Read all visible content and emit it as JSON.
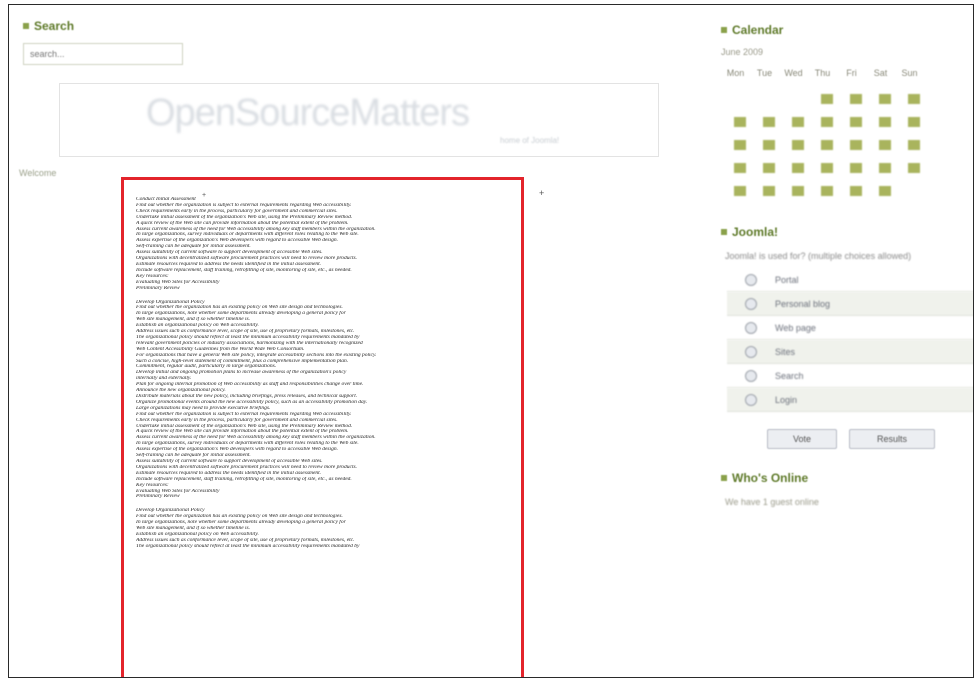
{
  "left": {
    "search_heading": "Search",
    "search_placeholder": "search...",
    "banner_logo": "OpenSourceMatters",
    "banner_tag": "home of Joomla!",
    "side_link": "Welcome"
  },
  "document": {
    "marker_top": "+",
    "marker_right": "+",
    "lines_block1": [
      "Conduct Initial Assessment",
      "Find out whether the organization is subject to external requirements regarding Web accessibility.",
      "Check requirements early in the process, particularly for government and commercial sites.",
      "Undertake initial assessment of the organization's Web site, using the Preliminary Review method.",
      "A quick review of the Web site can provide information about the potential extent of the problem.",
      "Assess current awareness of the need for Web accessibility among key staff members within the organization.",
      "In large organizations, survey individuals or departments with different roles relating to the Web site.",
      "Assess expertise of the organization's Web developers with regard to accessible Web design.",
      "Self-training can be adequate for initial assessment.",
      "Assess suitability of current software to support development of accessible Web sites.",
      "Organizations with decentralized software procurement practices will need to review more products.",
      "Estimate resources required to address the needs identified in the initial assessment.",
      "Include software replacement, staff training, retrofitting of site, monitoring of site, etc., as needed.",
      "Key resources:",
      "Evaluating Web Sites for Accessibility",
      "Preliminary Review"
    ],
    "lines_block2": [
      "Develop Organizational Policy",
      "Find out whether the organization has an existing policy on Web site design and technologies.",
      "In large organizations, note whether some departments already developing a general policy for",
      "Web site management, and if so whether timeline is.",
      "Establish an organizational policy on Web accessibility.",
      "Address issues such as conformance level, scope of site, use of proprietary formats, milestones, etc.",
      "The organizational policy should reflect at least the minimum accessibility requirements mandated by",
      "relevant government policies or industry associations, harmonizing with the internationally recognized",
      "Web Content Accessibility Guidelines from the World Wide Web Consortium.",
      "For organizations that have a general Web site policy, integrate accessibility sections into the existing policy.",
      "Such a concise, high-level statement of commitment, plus a comprehensive implementation plan.",
      "Commitment, regular audit, particularly in large organizations.",
      "Develop initial and ongoing promotion plans to increase awareness of the organization's policy",
      "internally and externally.",
      "Plan for ongoing internal promotion of Web accessibility as staff and responsibilities change over time.",
      "Announce the new organizational policy.",
      "Distribute materials about the new policy, including briefings, press releases, and technical support.",
      "Organize promotional events around the new accessibility policy, such as an accessibility promotion day.",
      "Large organizations may need to provide executive briefings.",
      "Find out whether the organization is subject to external requirements regarding Web accessibility.",
      "Check requirements early in the process, particularly for government and commercial sites.",
      "Undertake initial assessment of the organization's Web site, using the Preliminary Review method.",
      "A quick review of the Web site can provide information about the potential extent of the problem.",
      "Assess current awareness of the need for Web accessibility among key staff members within the organization.",
      "In large organizations, survey individuals or departments with different roles relating to the Web site.",
      "Assess expertise of the organization's Web developers with regard to accessible Web design.",
      "Self-training can be adequate for initial assessment.",
      "Assess suitability of current software to support development of accessible Web sites.",
      "Organizations with decentralized software procurement practices will need to review more products.",
      "Estimate resources required to address the needs identified in the initial assessment.",
      "Include software replacement, staff training, retrofitting of site, monitoring of site, etc., as needed.",
      "Key resources:",
      "Evaluating Web Sites for Accessibility",
      "Preliminary Review"
    ],
    "lines_block3": [
      "Develop Organizational Policy",
      "Find out whether the organization has an existing policy on Web site design and technologies.",
      "In large organizations, note whether some departments already developing a general policy for",
      "Web site management, and if so whether timeline is.",
      "Establish an organizational policy on Web accessibility.",
      "Address issues such as conformance level, scope of site, use of proprietary formats, milestones, etc.",
      "The organizational policy should reflect at least the minimum accessibility requirements mandated by"
    ]
  },
  "calendar": {
    "heading": "Calendar",
    "month": "June 2009",
    "days": [
      "Mon",
      "Tue",
      "Wed",
      "Thu",
      "Fri",
      "Sat",
      "Sun"
    ]
  },
  "poll": {
    "heading": "Joomla!",
    "question": "Joomla! is used for? (multiple choices allowed)",
    "options": [
      "Portal",
      "Personal blog",
      "Web page",
      "Sites",
      "Search",
      "Login"
    ],
    "vote_button": "Vote",
    "results_button": "Results"
  },
  "who": {
    "heading": "Who's Online",
    "text": "We have 1 guest online"
  },
  "colors": {
    "heading": "#5f7a2a",
    "calendar_cell": "#a9b45d",
    "doc_border": "#e3242b"
  }
}
